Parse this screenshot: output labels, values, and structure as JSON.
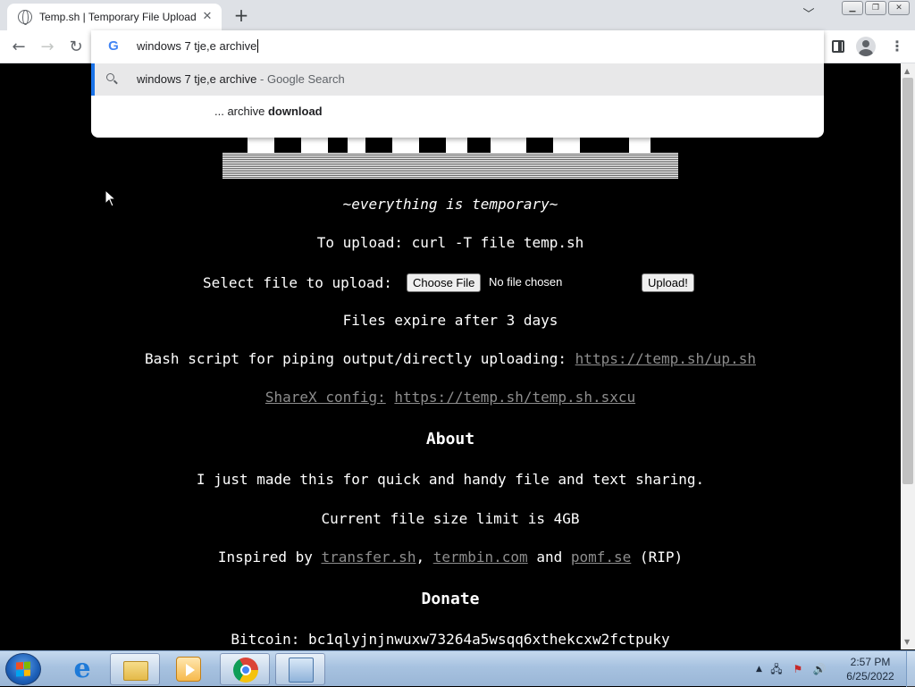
{
  "browser": {
    "tab_title": "Temp.sh | Temporary File Upload",
    "new_tab_symbol": "+",
    "tab_close_symbol": "✕",
    "omnibox_text": "windows 7 tje,e archive",
    "suggestions": [
      {
        "text": "windows 7 tje,e archive",
        "suffix": " - Google Search",
        "icon": "search-icon"
      },
      {
        "prefix": "... archive ",
        "bold": "download"
      }
    ]
  },
  "page": {
    "tagline": "~everything is temporary~",
    "upload_cmd": "To upload: curl -T file temp.sh",
    "select_label": "Select file to upload:",
    "choose_file": "Choose File",
    "no_file": "No file chosen",
    "upload_btn": "Upload!",
    "expire": "Files expire after 3 days",
    "bash_prefix": "Bash script for piping output/directly uploading: ",
    "bash_link": "https://temp.sh/up.sh",
    "sharex_label": "ShareX config:",
    "sharex_link": "https://temp.sh/temp.sh.sxcu",
    "about_heading": "About",
    "about_text": "I just made this for quick and handy file and text sharing.",
    "size_limit": "Current file size limit is 4GB",
    "inspired_prefix": "Inspired by ",
    "inspired_link1": "transfer.sh",
    "inspired_sep1": ", ",
    "inspired_link2": "termbin.com",
    "inspired_sep2": " and ",
    "inspired_link3": "pomf.se",
    "inspired_suffix": " (RIP)",
    "donate_heading": "Donate",
    "bitcoin": "Bitcoin: bc1qlyjnjnwuxw73264a5wsqq6xthekcxw2fctpuky"
  },
  "taskbar": {
    "time": "2:57 PM",
    "date": "6/25/2022"
  },
  "colors": {
    "page_bg": "#000000",
    "text": "#ffffff",
    "link": "#8d8d8d",
    "omnibox_highlight": "#1a73e8"
  }
}
